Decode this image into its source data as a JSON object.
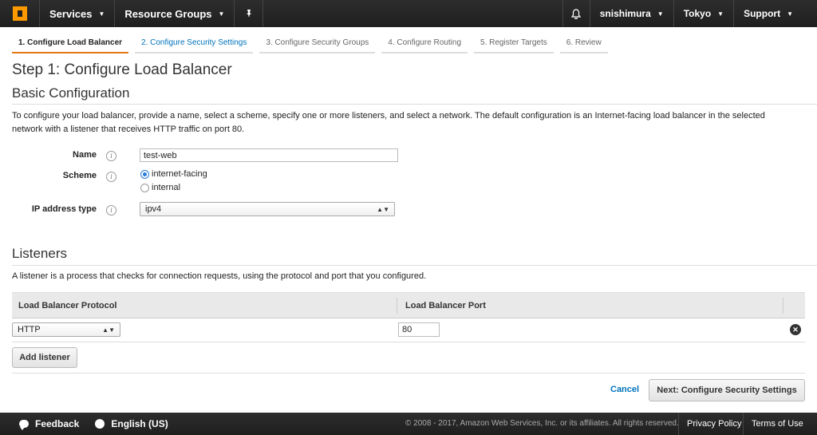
{
  "nav": {
    "services": "Services",
    "resource_groups": "Resource Groups",
    "user": "snishimura",
    "region": "Tokyo",
    "support": "Support"
  },
  "tabs": [
    {
      "label": "1. Configure Load Balancer"
    },
    {
      "label": "2. Configure Security Settings"
    },
    {
      "label": "3. Configure Security Groups"
    },
    {
      "label": "4. Configure Routing"
    },
    {
      "label": "5. Register Targets"
    },
    {
      "label": "6. Review"
    }
  ],
  "page": {
    "title": "Step 1: Configure Load Balancer",
    "basic_heading": "Basic Configuration",
    "description": "To configure your load balancer, provide a name, select a scheme, specify one or more listeners, and select a network. The default configuration is an Internet-facing load balancer in the selected network with a listener that receives HTTP traffic on port 80."
  },
  "form": {
    "name_label": "Name",
    "name_value": "test-web",
    "scheme_label": "Scheme",
    "scheme_options": [
      "internet-facing",
      "internal"
    ],
    "scheme_selected": "internet-facing",
    "ip_label": "IP address type",
    "ip_value": "ipv4"
  },
  "listeners": {
    "heading": "Listeners",
    "description": "A listener is a process that checks for connection requests, using the protocol and port that you configured.",
    "col_protocol": "Load Balancer Protocol",
    "col_port": "Load Balancer Port",
    "rows": [
      {
        "protocol": "HTTP",
        "port": "80"
      }
    ],
    "add_button": "Add listener"
  },
  "actions": {
    "cancel": "Cancel",
    "next": "Next: Configure Security Settings"
  },
  "footer": {
    "feedback": "Feedback",
    "language": "English (US)",
    "copyright": "© 2008 - 2017, Amazon Web Services, Inc. or its affiliates. All rights reserved.",
    "privacy": "Privacy Policy",
    "terms": "Terms of Use"
  }
}
